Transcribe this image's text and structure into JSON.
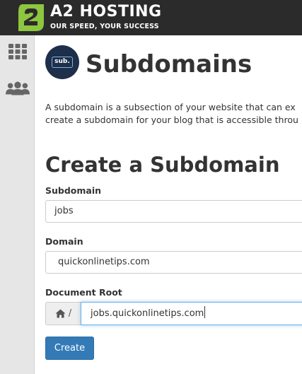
{
  "header": {
    "brand_name": "A2 HOSTING",
    "tagline": "OUR SPEED, YOUR SUCCESS",
    "logo_icon": "a2-logo-icon",
    "brand_color": "#8dc63f",
    "background_color": "#2b2b2b"
  },
  "sidebar": {
    "items": [
      {
        "icon": "grid-icon",
        "label": ""
      },
      {
        "icon": "users-icon",
        "label": ""
      }
    ]
  },
  "page": {
    "icon_text": "sub.",
    "title": "Subdomains",
    "description_line1": "A subdomain is a subsection of your website that can ex",
    "description_line2": "create a subdomain for your blog that is accessible throu"
  },
  "form": {
    "section_title": "Create a Subdomain",
    "subdomain_label": "Subdomain",
    "subdomain_value": "jobs",
    "domain_label": "Domain",
    "domain_value": "quickonlinetips.com",
    "docroot_label": "Document Root",
    "docroot_prefix": "/",
    "docroot_value": "jobs.quickonlinetips.com",
    "submit_label": "Create",
    "accent_color": "#337ab7"
  }
}
